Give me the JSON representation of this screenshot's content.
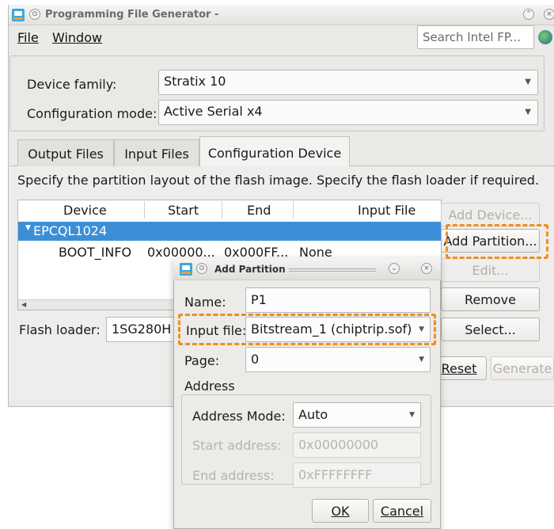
{
  "main_window": {
    "title": "Programming File Generator -",
    "menu": [
      "File",
      "Window"
    ],
    "search_placeholder": "Search Intel FP...",
    "device_family_label": "Device family:",
    "device_family_value": "Stratix 10",
    "config_mode_label": "Configuration mode:",
    "config_mode_value": "Active Serial x4",
    "tabs": [
      "Output Files",
      "Input Files",
      "Configuration Device"
    ],
    "active_tab": "Configuration Device",
    "instruction": "Specify the partition layout of the flash image. Specify the flash loader if required.",
    "table": {
      "columns": [
        "Device",
        "Start",
        "End",
        "Input File"
      ],
      "rows": [
        {
          "device": "EPCQL1024",
          "start": "",
          "end": "",
          "input_file": "",
          "selected": true
        },
        {
          "device": "BOOT_INFO",
          "start": "0x00000...",
          "end": "0x000FF...",
          "input_file": "None",
          "selected": false
        }
      ]
    },
    "side_buttons": {
      "add_device": "Add Device...",
      "add_partition": "Add Partition...",
      "edit": "Edit...",
      "remove": "Remove",
      "select": "Select..."
    },
    "flash_loader_label": "Flash loader:",
    "flash_loader_value": "1SG280H",
    "bottom_buttons": {
      "reset": "Reset",
      "generate": "Generate"
    }
  },
  "dialog": {
    "title": "Add Partition",
    "name_label": "Name:",
    "name_value": "P1",
    "input_file_label": "Input file:",
    "input_file_value": "Bitstream_1 (chiptrip.sof)",
    "page_label": "Page:",
    "page_value": "0",
    "address_group_label": "Address",
    "address_mode_label": "Address Mode:",
    "address_mode_value": "Auto",
    "start_address_label": "Start address:",
    "start_address_value": "0x00000000",
    "end_address_label": "End address:",
    "end_address_value": "0xFFFFFFFF",
    "ok_label": "OK",
    "cancel_label": "Cancel"
  },
  "colors": {
    "selection": "#3c8fd6",
    "highlight": "#f08c1e"
  }
}
